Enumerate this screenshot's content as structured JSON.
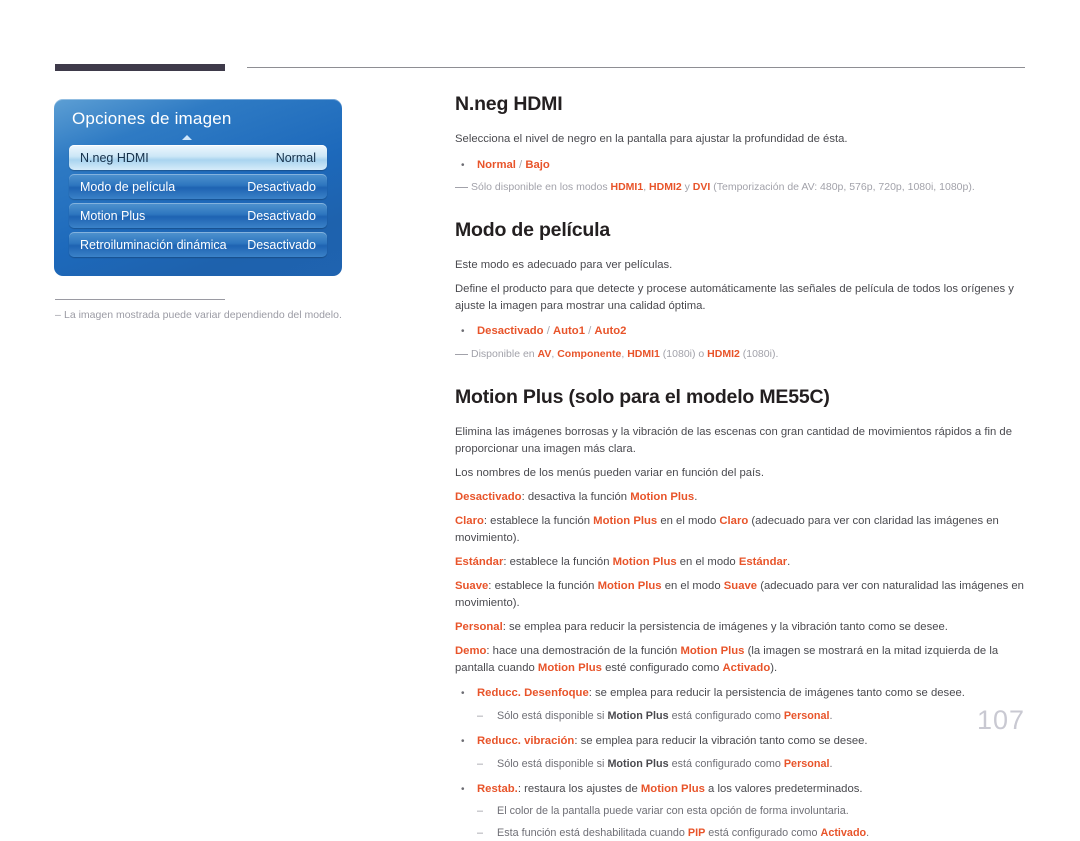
{
  "page": {
    "number": "107"
  },
  "osd": {
    "title": "Opciones de imagen",
    "rows": [
      {
        "label": "N.neg HDMI",
        "value": "Normal",
        "selected": true
      },
      {
        "label": "Modo de película",
        "value": "Desactivado",
        "selected": false
      },
      {
        "label": "Motion Plus",
        "value": "Desactivado",
        "selected": false
      },
      {
        "label": "Retroiluminación dinámica",
        "value": "Desactivado",
        "selected": false
      }
    ]
  },
  "left_note": {
    "dash": "‒",
    "text": "La imagen mostrada puede variar dependiendo del modelo."
  },
  "sections": {
    "hdmi_black": {
      "title": "N.neg HDMI",
      "intro": "Selecciona el nivel de negro en la pantalla para ajustar la profundidad de ésta.",
      "bullet_dot": "•",
      "options_1": "Normal",
      "options_sep_1": " / ",
      "options_2": "Bajo",
      "note_prefix": "Sólo disponible en los modos ",
      "note_k1": "HDMI1",
      "note_sep1": ", ",
      "note_k2": "HDMI2",
      "note_sep2": " y ",
      "note_k3": "DVI",
      "note_suffix": " (Temporización de AV: 480p, 576p, 720p, 1080i, 1080p)."
    },
    "film_mode": {
      "title": "Modo de película",
      "para1": "Este modo es adecuado para ver películas.",
      "para2": "Define el producto para que detecte y procese automáticamente las señales de película de todos los orígenes y ajuste la imagen para mostrar una calidad óptima.",
      "bullet_dot": "•",
      "opt1": "Desactivado",
      "opt_sep1": " / ",
      "opt2": "Auto1",
      "opt_sep2": " / ",
      "opt3": "Auto2",
      "note_prefix": "Disponible en ",
      "note_k1": "AV",
      "note_sep1": ", ",
      "note_k2": "Componente",
      "note_sep2": ", ",
      "note_k3": "HDMI1",
      "note_mid": " (1080i) o ",
      "note_k4": "HDMI2",
      "note_suffix": " (1080i)."
    },
    "motion_plus": {
      "title": "Motion Plus (solo para el modelo ME55C)",
      "para1": "Elimina las imágenes borrosas y la vibración de las escenas con gran cantidad de movimientos rápidos a fin de proporcionar una imagen más clara.",
      "para2": "Los nombres de los menús pueden variar en función del país.",
      "defs": [
        {
          "term": "Desactivado",
          "rest_1": ": desactiva la función ",
          "bold_1": "Motion Plus",
          "rest_2": "."
        },
        {
          "term": "Claro",
          "rest_1": ": establece la función ",
          "bold_1": "Motion Plus",
          "rest_2": " en el modo ",
          "accent_1": "Claro",
          "rest_3": " (adecuado para ver con claridad las imágenes en movimiento)."
        },
        {
          "term": "Estándar",
          "rest_1": ": establece la función ",
          "bold_1": "Motion Plus",
          "rest_2": " en el modo ",
          "accent_1": "Estándar",
          "rest_3": "."
        },
        {
          "term": "Suave",
          "rest_1": ": establece la función ",
          "bold_1": "Motion Plus",
          "rest_2": " en el modo ",
          "accent_1": "Suave",
          "rest_3": " (adecuado para ver con naturalidad las imágenes en movimiento)."
        },
        {
          "term": "Personal",
          "rest_1": ": se emplea para reducir la persistencia de imágenes y la vibración tanto como se desee."
        },
        {
          "term": "Demo",
          "rest_1": ": hace una demostración de la función ",
          "bold_1": "Motion Plus",
          "rest_2": " (la imagen se mostrará en la mitad izquierda de la pantalla cuando ",
          "bold_2": "Motion Plus",
          "rest_3": " esté configurado como ",
          "accent_1": "Activado",
          "rest_4": ")."
        }
      ],
      "bullet_dot": "•",
      "sub_dash": "‒",
      "bullets": [
        {
          "term": "Reducc. Desenfoque",
          "rest": ": se emplea para reducir la persistencia de imágenes tanto como se desee.",
          "subs": [
            {
              "pre": "Sólo está disponible si ",
              "bold_1": "Motion Plus",
              "mid": " está configurado como ",
              "accent_1": "Personal",
              "post": "."
            }
          ]
        },
        {
          "term": "Reducc. vibración",
          "rest": ": se emplea para reducir la vibración tanto como se desee.",
          "subs": [
            {
              "pre": "Sólo está disponible si ",
              "bold_1": "Motion Plus",
              "mid": " está configurado como ",
              "accent_1": "Personal",
              "post": "."
            }
          ]
        },
        {
          "term": "Restab.",
          "rest_pre": ": restaura los ajustes de ",
          "bold_1": "Motion Plus",
          "rest_post": " a los valores predeterminados.",
          "subs": [
            {
              "plain": "El color de la pantalla puede variar con esta opción de forma involuntaria."
            },
            {
              "pre": "Esta función está deshabilitada cuando ",
              "accent_0": "PIP",
              "mid": " está configurado como ",
              "accent_1": "Activado",
              "post": "."
            }
          ]
        }
      ]
    }
  },
  "colors": {
    "accent_orange": "#e8542a",
    "osd_blue": "#1d69bb",
    "header_bar": "#3e3a4a",
    "page_number": "#c9c9d2"
  }
}
